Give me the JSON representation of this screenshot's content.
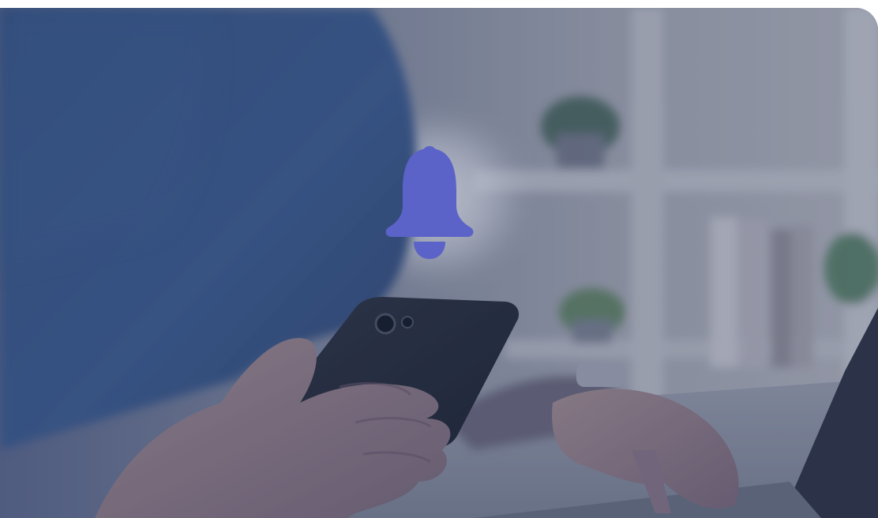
{
  "hero": {
    "image_name": "person-using-smartphone-photo",
    "overlay_color": "#2d3f6b"
  },
  "notification_icon": {
    "name": "bell-icon",
    "color": "#5b63c8"
  }
}
